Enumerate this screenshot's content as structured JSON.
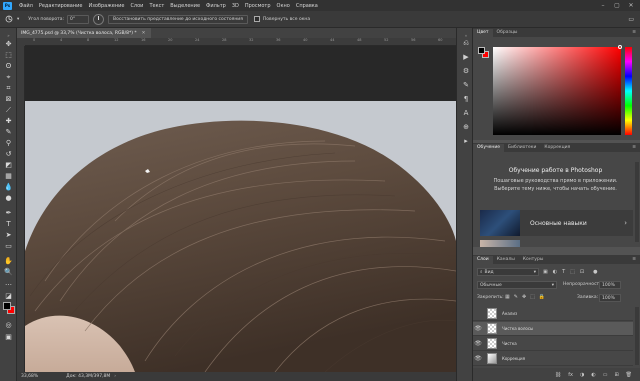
{
  "app": {
    "logo": "Ps"
  },
  "menu": [
    "Файл",
    "Редактирование",
    "Изображение",
    "Слои",
    "Текст",
    "Выделение",
    "Фильтр",
    "3D",
    "Просмотр",
    "Окно",
    "Справка"
  ],
  "options": {
    "feather_label": "Угол поворота:",
    "feather_value": "0°",
    "reset_button": "Восстановить представление до исходного состояния",
    "rotate_all_label": "Повернуть все окна"
  },
  "document": {
    "tab_title": "IMG_4775.psd @ 33,7% (Чистка волоса, RGB/8*) *",
    "zoom": "33,68%",
    "doc_info": "Док: 43,3М/397,8М",
    "ruler_marks": [
      "0",
      "4",
      "8",
      "12",
      "16",
      "20",
      "24",
      "28",
      "32",
      "36",
      "40",
      "44",
      "48",
      "52",
      "56",
      "60"
    ]
  },
  "color_panel": {
    "tabs": [
      "Цвет",
      "Образцы"
    ],
    "fg": "#000000",
    "bg": "#ff0000"
  },
  "learn_panel": {
    "tabs": [
      "Обучение",
      "Библиотеки",
      "Коррекция"
    ],
    "title": "Обучение работе в Photoshop",
    "body": "Пошаговые руководства прямо в приложении. Выберите тему ниже, чтобы начать обучение.",
    "item1": "Основные навыки"
  },
  "layers_panel": {
    "tabs": [
      "Слои",
      "Каналы",
      "Контуры"
    ],
    "filter": "Вид",
    "blend_mode": "Обычные",
    "opacity_label": "Непрозрачность:",
    "opacity_value": "100%",
    "lock_label": "Закрепить:",
    "fill_label": "Заливка:",
    "fill_value": "100%",
    "layers": [
      {
        "name": "Анализ",
        "visible": false
      },
      {
        "name": "Чистка волосы",
        "visible": true,
        "selected": true
      },
      {
        "name": "Чистка",
        "visible": true
      },
      {
        "name": "Коррекция",
        "visible": true
      }
    ]
  }
}
